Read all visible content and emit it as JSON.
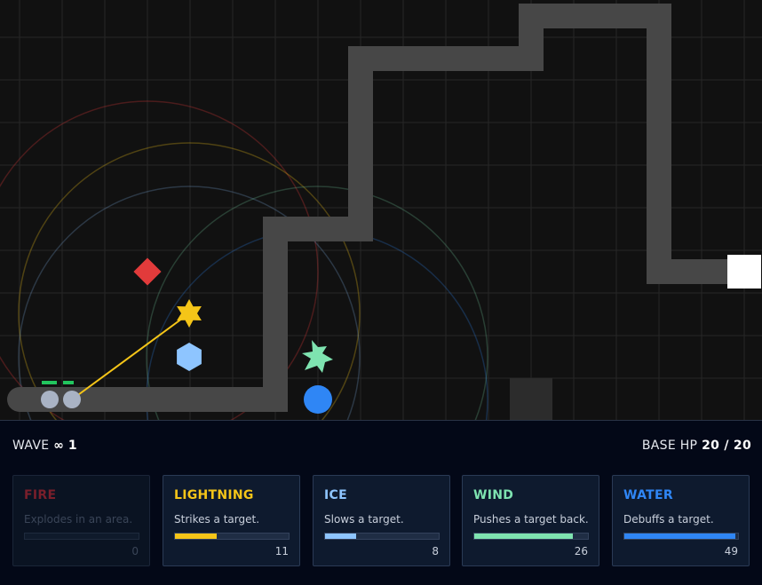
{
  "hud": {
    "wave_label": "WAVE",
    "wave_symbol": "∞",
    "wave_number": "1",
    "base_hp_label": "BASE HP",
    "base_hp_value": "20 / 20"
  },
  "towers": [
    {
      "name": "FIRE",
      "description": "Explodes in an area.",
      "count": "0",
      "charge": 0.0,
      "color": "#7a1f2b",
      "enabled": false
    },
    {
      "name": "LIGHTNING",
      "description": "Strikes a target.",
      "count": "11",
      "charge": 0.37,
      "color": "#f5c518",
      "enabled": true
    },
    {
      "name": "ICE",
      "description": "Slows a target.",
      "count": "8",
      "charge": 0.27,
      "color": "#8ec5ff",
      "enabled": true
    },
    {
      "name": "WIND",
      "description": "Pushes a target back.",
      "count": "26",
      "charge": 0.87,
      "color": "#7ee3b0",
      "enabled": true
    },
    {
      "name": "WATER",
      "description": "Debuffs a target.",
      "count": "49",
      "charge": 0.98,
      "color": "#2f86f5",
      "enabled": true
    }
  ],
  "field_colors": {
    "background": "#111111",
    "grid": "#262626",
    "path": "#474747",
    "base": "#ffffff",
    "enemy": "#a9b3c4",
    "enemy_health": "#22c55e",
    "fire_tower": "#e23b3b",
    "lightning_tower": "#f5c518",
    "ice_tower": "#8ec5ff",
    "wind_tower": "#7ee3b0",
    "water_tower": "#2f86f5"
  }
}
